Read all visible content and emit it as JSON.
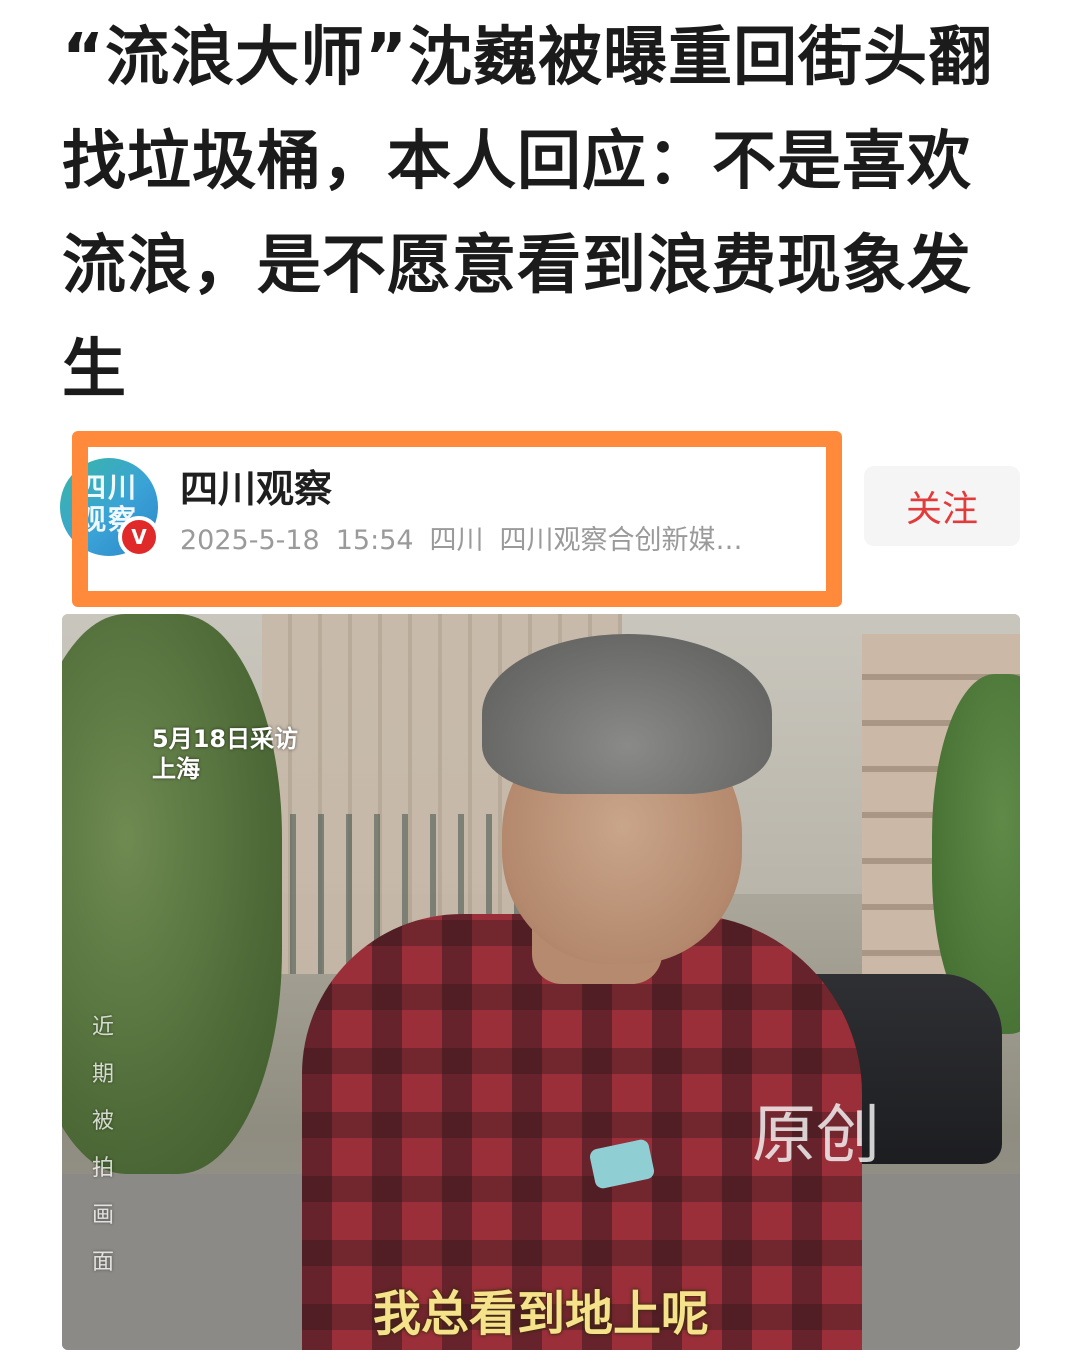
{
  "article": {
    "title": "“流浪大师”沈巍被曝重回街头翻找垃圾桶，本人回应：不是喜欢流浪，是不愿意看到浪费现象发生"
  },
  "author": {
    "avatar_text": "四川观察",
    "verified_badge": "V",
    "name": "四川观察",
    "date": "2025-5-18",
    "time": "15:54",
    "location": "四川",
    "org": "四川观察合创新媒…"
  },
  "actions": {
    "follow_label": "关注"
  },
  "image": {
    "overlay_date": "5月18日采访",
    "overlay_place": "上海",
    "vertical_caption": "近期被拍画面",
    "watermark": "原创",
    "subtitle": "我总看到地上呢"
  },
  "colors": {
    "highlight_border": "#ff8a3c",
    "follow_text": "#e23b3b",
    "verified": "#e02a2a"
  }
}
